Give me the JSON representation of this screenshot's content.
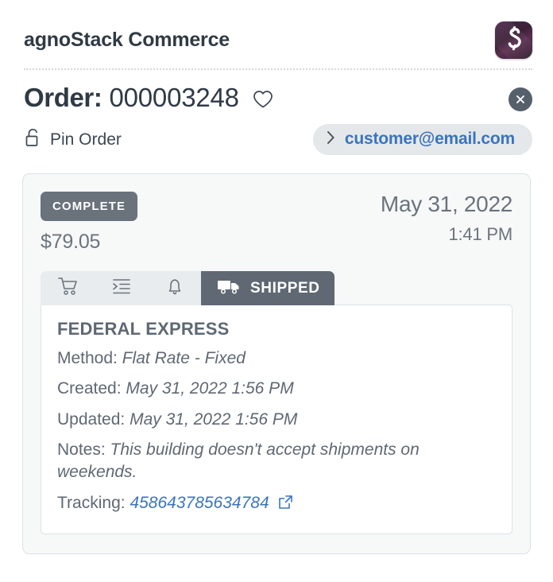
{
  "header": {
    "brand_title": "agnoStack Commerce",
    "logo_alt": "agnostack-logo"
  },
  "order": {
    "label": "Order:",
    "number": "000003248",
    "favorite_icon": "heart-icon",
    "close_icon": "close-icon",
    "pin_label": "Pin Order",
    "pin_icon": "unlock-icon",
    "customer_email": "customer@email.com",
    "chevron_icon": "chevron-right-icon"
  },
  "summary": {
    "status": "COMPLETE",
    "total": "$79.05",
    "date": "May 31, 2022",
    "time": "1:41 PM",
    "status_color": "#6a727c"
  },
  "tabs": [
    {
      "id": "cart",
      "icon": "shopping-cart-icon",
      "label": ""
    },
    {
      "id": "items",
      "icon": "list-indent-icon",
      "label": ""
    },
    {
      "id": "notifications",
      "icon": "bell-icon",
      "label": ""
    },
    {
      "id": "shipped",
      "icon": "truck-icon",
      "label": "SHIPPED"
    }
  ],
  "shipment": {
    "carrier": "FEDERAL EXPRESS",
    "method_label": "Method:",
    "method_value": "Flat Rate - Fixed",
    "created_label": "Created:",
    "created_value": "May 31, 2022 1:56 PM",
    "updated_label": "Updated:",
    "updated_value": "May 31, 2022 1:56 PM",
    "notes_label": "Notes:",
    "notes_value": "This building doesn't accept shipments on weekends.",
    "tracking_label": "Tracking:",
    "tracking_value": "458643785634784",
    "tracking_icon": "external-link-icon",
    "link_color": "#3a74be"
  }
}
